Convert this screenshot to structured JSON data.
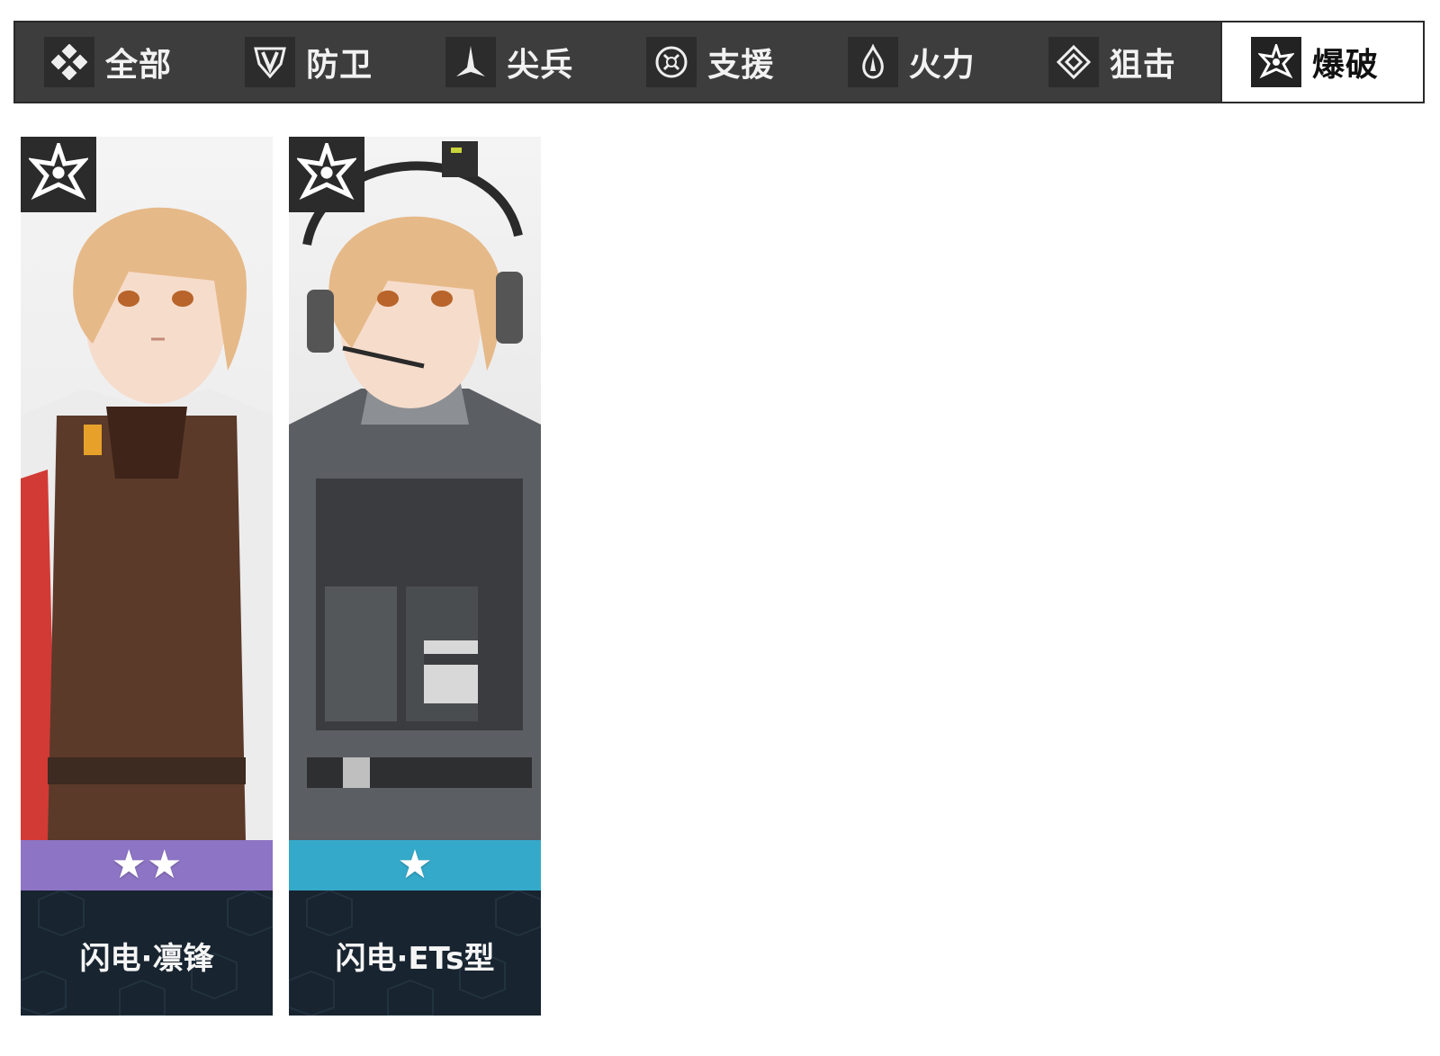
{
  "tabs": [
    {
      "label": "全部",
      "icon": "all-icon",
      "active": false
    },
    {
      "label": "防卫",
      "icon": "defense-icon",
      "active": false
    },
    {
      "label": "尖兵",
      "icon": "vanguard-icon",
      "active": false
    },
    {
      "label": "支援",
      "icon": "support-icon",
      "active": false
    },
    {
      "label": "火力",
      "icon": "firepower-icon",
      "active": false
    },
    {
      "label": "狙击",
      "icon": "sniper-icon",
      "active": false
    },
    {
      "label": "爆破",
      "icon": "demolition-icon",
      "active": true
    }
  ],
  "cards": [
    {
      "name": "闪电·凛锋",
      "stars": "★★",
      "rarity_count": 2,
      "rarity_color": "#8d74c4",
      "class_icon": "demolition-icon"
    },
    {
      "name": "闪电·ETs型",
      "stars": "★",
      "rarity_count": 1,
      "rarity_color": "#35a9c9",
      "class_icon": "demolition-icon"
    }
  ],
  "colors": {
    "tabbar_bg": "#3d3d3d",
    "tab_active_bg": "#ffffff",
    "name_panel_bg": "#182430"
  }
}
